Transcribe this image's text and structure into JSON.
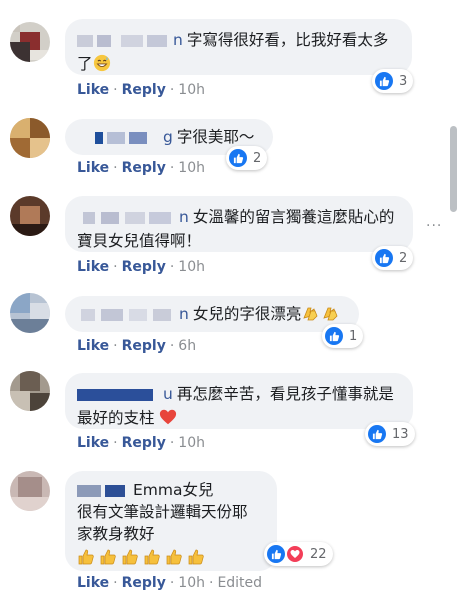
{
  "colors": {
    "link": "#385898",
    "like": "#1877f2",
    "heart": "#f33e58",
    "bubble": "#f0f2f5"
  },
  "comments": [
    {
      "name_tail": "n",
      "text": "字寫得很好看，比我好看太多了",
      "emoji": "grinning-sweat-emoji",
      "reactions": "3",
      "like": "Like",
      "reply": "Reply",
      "time": "10h"
    },
    {
      "name_tail": "g",
      "text": "字很美耶～",
      "reactions": "2",
      "like": "Like",
      "reply": "Reply",
      "time": "10h"
    },
    {
      "name_tail": "n",
      "text": "女溫馨的留言獨養這麼貼心的寶貝女兒值得啊！",
      "reactions": "2",
      "like": "Like",
      "reply": "Reply",
      "time": "10h"
    },
    {
      "name_tail": "n",
      "text": "女兒的字很漂亮",
      "emoji": "clapping-hands-emoji",
      "reactions": "1",
      "like": "Like",
      "reply": "Reply",
      "time": "6h"
    },
    {
      "name_tail": "u",
      "text": "再怎麼辛苦，看見孩子懂事就是最好的支柱",
      "emoji": "red-heart-emoji",
      "reactions": "13",
      "like": "Like",
      "reply": "Reply",
      "time": "10h"
    },
    {
      "mention": "Emma女兒",
      "line2": "很有文筆設計邏輯天份耶",
      "line3": "家教身教好",
      "emoji": "thumbs-up-emoji",
      "reactions": "22",
      "like": "Like",
      "reply": "Reply",
      "time": "10h",
      "edited": "Edited"
    }
  ]
}
